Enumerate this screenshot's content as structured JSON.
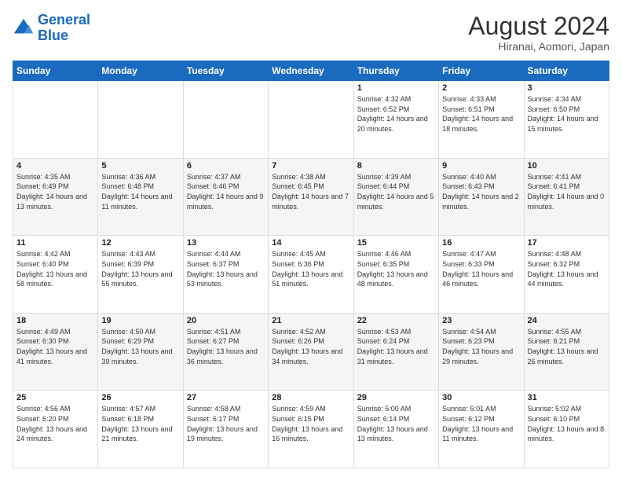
{
  "header": {
    "logo_line1": "General",
    "logo_line2": "Blue",
    "title": "August 2024",
    "subtitle": "Hiranai, Aomori, Japan"
  },
  "days_of_week": [
    "Sunday",
    "Monday",
    "Tuesday",
    "Wednesday",
    "Thursday",
    "Friday",
    "Saturday"
  ],
  "weeks": [
    [
      {
        "day": "",
        "info": ""
      },
      {
        "day": "",
        "info": ""
      },
      {
        "day": "",
        "info": ""
      },
      {
        "day": "",
        "info": ""
      },
      {
        "day": "1",
        "info": "Sunrise: 4:32 AM\nSunset: 6:52 PM\nDaylight: 14 hours and 20 minutes."
      },
      {
        "day": "2",
        "info": "Sunrise: 4:33 AM\nSunset: 6:51 PM\nDaylight: 14 hours and 18 minutes."
      },
      {
        "day": "3",
        "info": "Sunrise: 4:34 AM\nSunset: 6:50 PM\nDaylight: 14 hours and 15 minutes."
      }
    ],
    [
      {
        "day": "4",
        "info": "Sunrise: 4:35 AM\nSunset: 6:49 PM\nDaylight: 14 hours and 13 minutes."
      },
      {
        "day": "5",
        "info": "Sunrise: 4:36 AM\nSunset: 6:48 PM\nDaylight: 14 hours and 11 minutes."
      },
      {
        "day": "6",
        "info": "Sunrise: 4:37 AM\nSunset: 6:46 PM\nDaylight: 14 hours and 9 minutes."
      },
      {
        "day": "7",
        "info": "Sunrise: 4:38 AM\nSunset: 6:45 PM\nDaylight: 14 hours and 7 minutes."
      },
      {
        "day": "8",
        "info": "Sunrise: 4:39 AM\nSunset: 6:44 PM\nDaylight: 14 hours and 5 minutes."
      },
      {
        "day": "9",
        "info": "Sunrise: 4:40 AM\nSunset: 6:43 PM\nDaylight: 14 hours and 2 minutes."
      },
      {
        "day": "10",
        "info": "Sunrise: 4:41 AM\nSunset: 6:41 PM\nDaylight: 14 hours and 0 minutes."
      }
    ],
    [
      {
        "day": "11",
        "info": "Sunrise: 4:42 AM\nSunset: 6:40 PM\nDaylight: 13 hours and 58 minutes."
      },
      {
        "day": "12",
        "info": "Sunrise: 4:43 AM\nSunset: 6:39 PM\nDaylight: 13 hours and 55 minutes."
      },
      {
        "day": "13",
        "info": "Sunrise: 4:44 AM\nSunset: 6:37 PM\nDaylight: 13 hours and 53 minutes."
      },
      {
        "day": "14",
        "info": "Sunrise: 4:45 AM\nSunset: 6:36 PM\nDaylight: 13 hours and 51 minutes."
      },
      {
        "day": "15",
        "info": "Sunrise: 4:46 AM\nSunset: 6:35 PM\nDaylight: 13 hours and 48 minutes."
      },
      {
        "day": "16",
        "info": "Sunrise: 4:47 AM\nSunset: 6:33 PM\nDaylight: 13 hours and 46 minutes."
      },
      {
        "day": "17",
        "info": "Sunrise: 4:48 AM\nSunset: 6:32 PM\nDaylight: 13 hours and 44 minutes."
      }
    ],
    [
      {
        "day": "18",
        "info": "Sunrise: 4:49 AM\nSunset: 6:30 PM\nDaylight: 13 hours and 41 minutes."
      },
      {
        "day": "19",
        "info": "Sunrise: 4:50 AM\nSunset: 6:29 PM\nDaylight: 13 hours and 39 minutes."
      },
      {
        "day": "20",
        "info": "Sunrise: 4:51 AM\nSunset: 6:27 PM\nDaylight: 13 hours and 36 minutes."
      },
      {
        "day": "21",
        "info": "Sunrise: 4:52 AM\nSunset: 6:26 PM\nDaylight: 13 hours and 34 minutes."
      },
      {
        "day": "22",
        "info": "Sunrise: 4:53 AM\nSunset: 6:24 PM\nDaylight: 13 hours and 31 minutes."
      },
      {
        "day": "23",
        "info": "Sunrise: 4:54 AM\nSunset: 6:23 PM\nDaylight: 13 hours and 29 minutes."
      },
      {
        "day": "24",
        "info": "Sunrise: 4:55 AM\nSunset: 6:21 PM\nDaylight: 13 hours and 26 minutes."
      }
    ],
    [
      {
        "day": "25",
        "info": "Sunrise: 4:56 AM\nSunset: 6:20 PM\nDaylight: 13 hours and 24 minutes."
      },
      {
        "day": "26",
        "info": "Sunrise: 4:57 AM\nSunset: 6:18 PM\nDaylight: 13 hours and 21 minutes."
      },
      {
        "day": "27",
        "info": "Sunrise: 4:58 AM\nSunset: 6:17 PM\nDaylight: 13 hours and 19 minutes."
      },
      {
        "day": "28",
        "info": "Sunrise: 4:59 AM\nSunset: 6:15 PM\nDaylight: 13 hours and 16 minutes."
      },
      {
        "day": "29",
        "info": "Sunrise: 5:00 AM\nSunset: 6:14 PM\nDaylight: 13 hours and 13 minutes."
      },
      {
        "day": "30",
        "info": "Sunrise: 5:01 AM\nSunset: 6:12 PM\nDaylight: 13 hours and 11 minutes."
      },
      {
        "day": "31",
        "info": "Sunrise: 5:02 AM\nSunset: 6:10 PM\nDaylight: 13 hours and 8 minutes."
      }
    ]
  ]
}
